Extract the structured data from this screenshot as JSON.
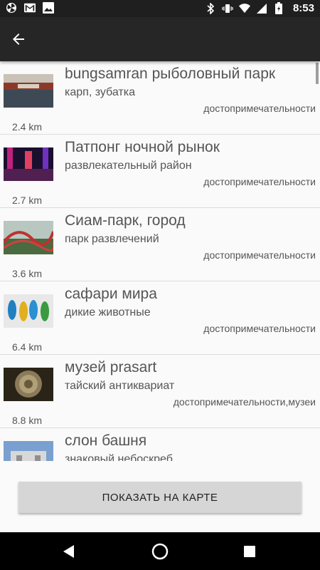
{
  "status_bar": {
    "time": "8:53",
    "left_icons": [
      "pinwheel-icon",
      "gmail-icon",
      "image-icon"
    ],
    "right_icons": [
      "bluetooth-icon",
      "vibrate-icon",
      "wifi-icon",
      "signal-icon",
      "battery-icon"
    ]
  },
  "app_bar": {
    "back_icon": "arrow-left-icon"
  },
  "items": [
    {
      "title": "bungsamran рыболовный парк",
      "subtitle": "карп, зубатка",
      "category": "достопримечательности",
      "distance": "2.4 km"
    },
    {
      "title": "Патпонг ночной рынок",
      "subtitle": "развлекательный район",
      "category": "достопримечательности",
      "distance": "2.7 km"
    },
    {
      "title": "Сиам-парк, город",
      "subtitle": "парк развлечений",
      "category": "достопримечательности",
      "distance": "3.6 km"
    },
    {
      "title": "сафари мира",
      "subtitle": "дикие животные",
      "category": "достопримечательности",
      "distance": "6.4 km"
    },
    {
      "title": "музей prasart",
      "subtitle": "тайский антиквариат",
      "category": "достопримечательности,музеи",
      "distance": "8.8 km"
    },
    {
      "title": "слон башня",
      "subtitle": "знаковый небоскреб",
      "category": "",
      "distance": ""
    }
  ],
  "map_button": {
    "label": "ПОКАЗАТЬ НА КАРТЕ"
  },
  "nav_bar": {
    "icons": [
      "back-triangle-icon",
      "home-circle-icon",
      "recents-square-icon"
    ]
  },
  "colors": {
    "app_bar": "#262626",
    "status_bar": "#1f1f1f",
    "button": "#d6d6d6",
    "text": "#555555"
  }
}
